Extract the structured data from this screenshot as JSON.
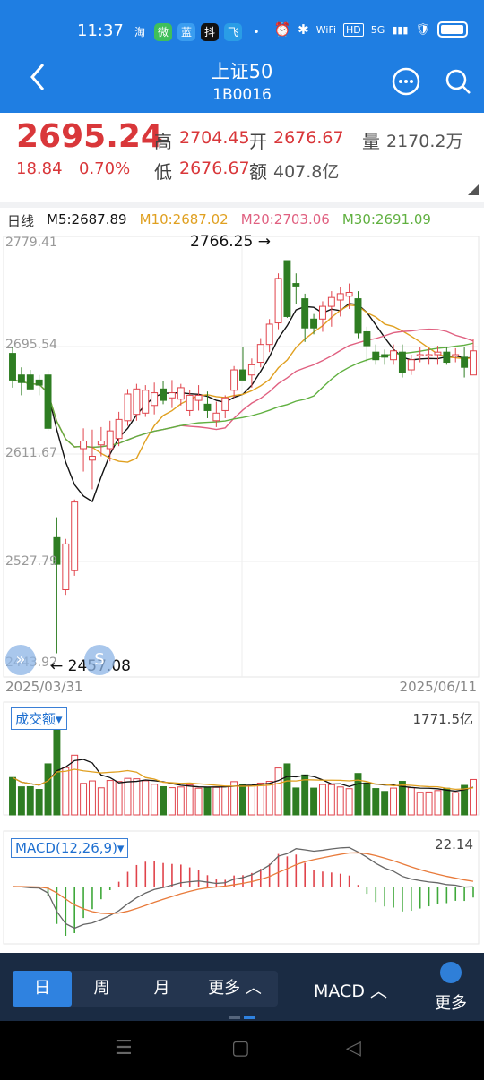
{
  "status": {
    "time": "11:37",
    "apps": [
      "淘",
      "微",
      "蓝",
      "抖",
      "飞"
    ],
    "sys": [
      "⏰",
      "✱",
      "WiFi",
      "HD",
      "5G",
      "▮▮▮",
      "🛡"
    ]
  },
  "header": {
    "title": "上证50",
    "code": "1B0016"
  },
  "quote": {
    "price": "2695.24",
    "change": "18.84",
    "change_pct": "0.70%",
    "high_label": "高",
    "high": "2704.45",
    "open_label": "开",
    "open": "2676.67",
    "vol_label": "量",
    "vol": "2170.2万",
    "low_label": "低",
    "low": "2676.67",
    "amt_label": "额",
    "amt": "407.8亿"
  },
  "ma": {
    "period": "日线",
    "m5": "M5:2687.89",
    "m10": "M10:2687.02",
    "m20": "M20:2703.06",
    "m30": "M30:2691.09",
    "colors": {
      "m5": "#111111",
      "m10": "#e0a020",
      "m20": "#e06080",
      "m30": "#60b040"
    }
  },
  "price_axis": [
    "2779.41",
    "2695.54",
    "2611.67",
    "2527.79",
    "2443.92"
  ],
  "annotations": {
    "high": "2766.25",
    "low": "2457.08"
  },
  "dates": {
    "start": "2025/03/31",
    "end": "2025/06/11"
  },
  "volume": {
    "selector": "成交额▾",
    "value": "1771.5亿"
  },
  "macd": {
    "selector": "MACD(12,26,9)▾",
    "value": "22.14"
  },
  "toolbar": {
    "periods": [
      "日",
      "周",
      "月",
      "更多 ︿"
    ],
    "indicator": "MACD ︿",
    "more": "更多"
  },
  "navbar": {
    "menu": "☰",
    "home": "▢",
    "back": "◁"
  },
  "fab": {
    "left": "»",
    "right": "S"
  },
  "chart_data": {
    "type": "candlestick",
    "ylim": [
      2443.92,
      2779.41
    ],
    "candles": [
      {
        "o": 2693,
        "h": 2698,
        "l": 2666,
        "c": 2672
      },
      {
        "o": 2676,
        "h": 2682,
        "l": 2660,
        "c": 2670
      },
      {
        "o": 2676,
        "h": 2680,
        "l": 2665,
        "c": 2665
      },
      {
        "o": 2672,
        "h": 2676,
        "l": 2660,
        "c": 2668
      },
      {
        "o": 2676,
        "h": 2680,
        "l": 2632,
        "c": 2634
      },
      {
        "o": 2548,
        "h": 2564,
        "l": 2457,
        "c": 2527
      },
      {
        "o": 2507,
        "h": 2547,
        "l": 2503,
        "c": 2543
      },
      {
        "o": 2522,
        "h": 2578,
        "l": 2518,
        "c": 2576
      },
      {
        "o": 2618,
        "h": 2634,
        "l": 2600,
        "c": 2624
      },
      {
        "o": 2609,
        "h": 2633,
        "l": 2586,
        "c": 2612
      },
      {
        "o": 2621,
        "h": 2635,
        "l": 2612,
        "c": 2624
      },
      {
        "o": 2618,
        "h": 2640,
        "l": 2608,
        "c": 2632
      },
      {
        "o": 2626,
        "h": 2647,
        "l": 2620,
        "c": 2641
      },
      {
        "o": 2640,
        "h": 2665,
        "l": 2636,
        "c": 2661
      },
      {
        "o": 2645,
        "h": 2669,
        "l": 2640,
        "c": 2665
      },
      {
        "o": 2646,
        "h": 2668,
        "l": 2643,
        "c": 2664
      },
      {
        "o": 2652,
        "h": 2670,
        "l": 2645,
        "c": 2662
      },
      {
        "o": 2665,
        "h": 2671,
        "l": 2653,
        "c": 2656
      },
      {
        "o": 2658,
        "h": 2672,
        "l": 2650,
        "c": 2662
      },
      {
        "o": 2657,
        "h": 2669,
        "l": 2652,
        "c": 2666
      },
      {
        "o": 2648,
        "h": 2664,
        "l": 2644,
        "c": 2660
      },
      {
        "o": 2656,
        "h": 2668,
        "l": 2648,
        "c": 2660
      },
      {
        "o": 2653,
        "h": 2663,
        "l": 2642,
        "c": 2648
      },
      {
        "o": 2640,
        "h": 2655,
        "l": 2635,
        "c": 2646
      },
      {
        "o": 2648,
        "h": 2660,
        "l": 2642,
        "c": 2658
      },
      {
        "o": 2664,
        "h": 2683,
        "l": 2658,
        "c": 2680
      },
      {
        "o": 2680,
        "h": 2698,
        "l": 2672,
        "c": 2672
      },
      {
        "o": 2676,
        "h": 2689,
        "l": 2666,
        "c": 2684
      },
      {
        "o": 2686,
        "h": 2705,
        "l": 2682,
        "c": 2700
      },
      {
        "o": 2700,
        "h": 2720,
        "l": 2694,
        "c": 2716
      },
      {
        "o": 2717,
        "h": 2756,
        "l": 2712,
        "c": 2752
      },
      {
        "o": 2766,
        "h": 2766,
        "l": 2721,
        "c": 2722
      },
      {
        "o": 2748,
        "h": 2756,
        "l": 2732,
        "c": 2746
      },
      {
        "o": 2736,
        "h": 2740,
        "l": 2702,
        "c": 2713
      },
      {
        "o": 2720,
        "h": 2724,
        "l": 2708,
        "c": 2713
      },
      {
        "o": 2720,
        "h": 2734,
        "l": 2710,
        "c": 2730
      },
      {
        "o": 2730,
        "h": 2742,
        "l": 2714,
        "c": 2737
      },
      {
        "o": 2735,
        "h": 2745,
        "l": 2722,
        "c": 2740
      },
      {
        "o": 2738,
        "h": 2748,
        "l": 2728,
        "c": 2741
      },
      {
        "o": 2736,
        "h": 2742,
        "l": 2705,
        "c": 2709
      },
      {
        "o": 2710,
        "h": 2714,
        "l": 2686,
        "c": 2699
      },
      {
        "o": 2694,
        "h": 2700,
        "l": 2684,
        "c": 2688
      },
      {
        "o": 2692,
        "h": 2696,
        "l": 2684,
        "c": 2690
      },
      {
        "o": 2688,
        "h": 2700,
        "l": 2684,
        "c": 2695
      },
      {
        "o": 2694,
        "h": 2700,
        "l": 2674,
        "c": 2678
      },
      {
        "o": 2680,
        "h": 2692,
        "l": 2676,
        "c": 2688
      },
      {
        "o": 2692,
        "h": 2698,
        "l": 2686,
        "c": 2692
      },
      {
        "o": 2692,
        "h": 2697,
        "l": 2684,
        "c": 2692
      },
      {
        "o": 2692,
        "h": 2699,
        "l": 2684,
        "c": 2694
      },
      {
        "o": 2694,
        "h": 2698,
        "l": 2684,
        "c": 2686
      },
      {
        "o": 2692,
        "h": 2697,
        "l": 2686,
        "c": 2692
      },
      {
        "o": 2690,
        "h": 2698,
        "l": 2674,
        "c": 2682
      },
      {
        "o": 2676,
        "h": 2704,
        "l": 2676,
        "c": 2695
      }
    ]
  }
}
